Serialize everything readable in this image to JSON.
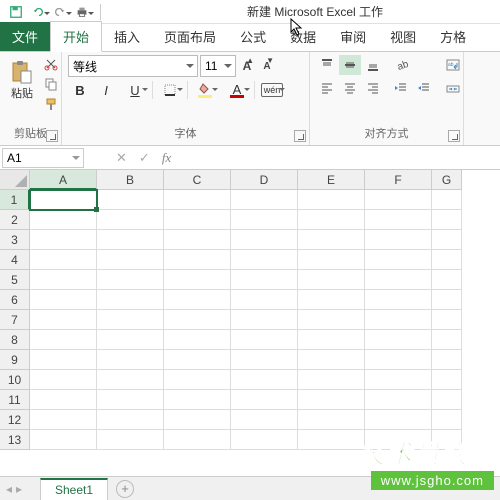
{
  "title": "新建 Microsoft Excel 工作",
  "tabs": {
    "file": "文件",
    "home": "开始",
    "insert": "插入",
    "layout": "页面布局",
    "formulas": "公式",
    "data": "数据",
    "review": "审阅",
    "view": "视图",
    "square": "方格"
  },
  "ribbon": {
    "clipboard": {
      "label": "剪贴板",
      "paste": "粘贴"
    },
    "font": {
      "label": "字体",
      "family": "等线",
      "size": "11",
      "bold": "B",
      "italic": "I",
      "underline": "U",
      "fontchar": "A",
      "wen": "wén"
    },
    "align": {
      "label": "对齐方式"
    }
  },
  "namebox": "A1",
  "fxbtn": {
    "cancel": "✕",
    "accept": "✓"
  },
  "columns": [
    "A",
    "B",
    "C",
    "D",
    "E",
    "F",
    "G"
  ],
  "rows": [
    "1",
    "2",
    "3",
    "4",
    "5",
    "6",
    "7",
    "8",
    "9",
    "10",
    "11",
    "12",
    "13"
  ],
  "sheet": {
    "name": "Sheet1",
    "add": "+"
  },
  "watermark": {
    "main": "技术员联盟",
    "url": "www.jsgho.com"
  }
}
